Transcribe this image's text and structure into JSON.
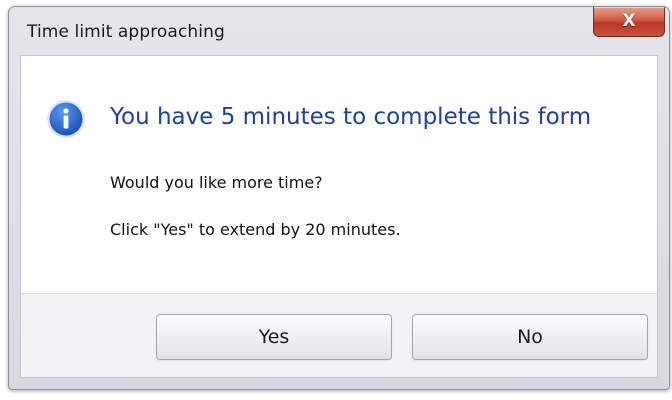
{
  "dialog": {
    "title": "Time limit approaching",
    "close_label": "X",
    "heading": "You have 5 minutes to complete this form",
    "message_line1": "Would you like more time?",
    "message_line2": "Click \"Yes\" to extend by 20 minutes.",
    "icon": "info-icon"
  },
  "buttons": {
    "yes_label": "Yes",
    "no_label": "No"
  },
  "colors": {
    "heading": "#1e3fa8",
    "info_icon": "#1f5fc4",
    "close_button": "#c9513c"
  }
}
